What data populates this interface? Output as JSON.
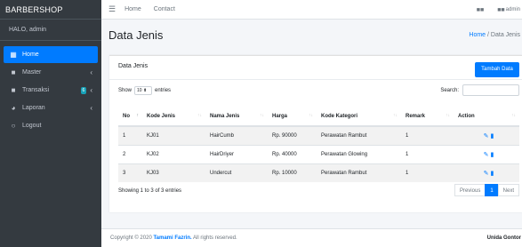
{
  "brand": "BARBERSHOP",
  "user_greeting": "HALO, admin",
  "sidebar": {
    "items": [
      {
        "label": "Home",
        "icon": "dashboard-icon",
        "glyph": "▦"
      },
      {
        "label": "Master",
        "icon": "book-icon",
        "glyph": "■",
        "caret": "‹"
      },
      {
        "label": "Transaksi",
        "icon": "book-icon",
        "glyph": "■",
        "badge": "6",
        "caret": "‹"
      },
      {
        "label": "Laporan",
        "icon": "pie-chart-icon",
        "glyph": "◕",
        "caret": "‹"
      },
      {
        "label": "Logout",
        "icon": "circle-icon",
        "glyph": "○"
      }
    ]
  },
  "topbar": {
    "links": [
      "Home",
      "Contact"
    ],
    "admin_label": "admin"
  },
  "page": {
    "title": "Data Jenis",
    "breadcrumb_home": "Home",
    "breadcrumb_sep": " / ",
    "breadcrumb_current": "Data Jenis"
  },
  "card": {
    "title": "Data Jenis",
    "add_button": "Tambah Data",
    "show_label": "Show",
    "entries_value": "10",
    "entries_label": "entries",
    "search_label": "Search:"
  },
  "table": {
    "headers": [
      "No",
      "Kode Jenis",
      "Nama Jenis",
      "Harga",
      "Kode Kategori",
      "Remark",
      "Action"
    ],
    "rows": [
      [
        "1",
        "KJ01",
        "HairCumb",
        "Rp. 90000",
        "Perawatan Rambut",
        "1"
      ],
      [
        "2",
        "KJ02",
        "HairDriyer",
        "Rp. 40000",
        "Perawatan Glowing",
        "1"
      ],
      [
        "3",
        "KJ03",
        "Undercut",
        "Rp. 10000",
        "Perawatan Rambut",
        "1"
      ]
    ]
  },
  "info": "Showing 1 to 3 of 3 entries",
  "pagination": {
    "previous": "Previous",
    "current": "1",
    "next": "Next"
  },
  "footer": {
    "prefix": "Copyright © 2020 ",
    "name": "Tamami Fazrin.",
    "suffix": " All rights reserved.",
    "right": "Unida Gontor"
  },
  "colors": {
    "primary": "#007bff",
    "sidebar": "#343a40",
    "badge": "#17a2b8"
  }
}
